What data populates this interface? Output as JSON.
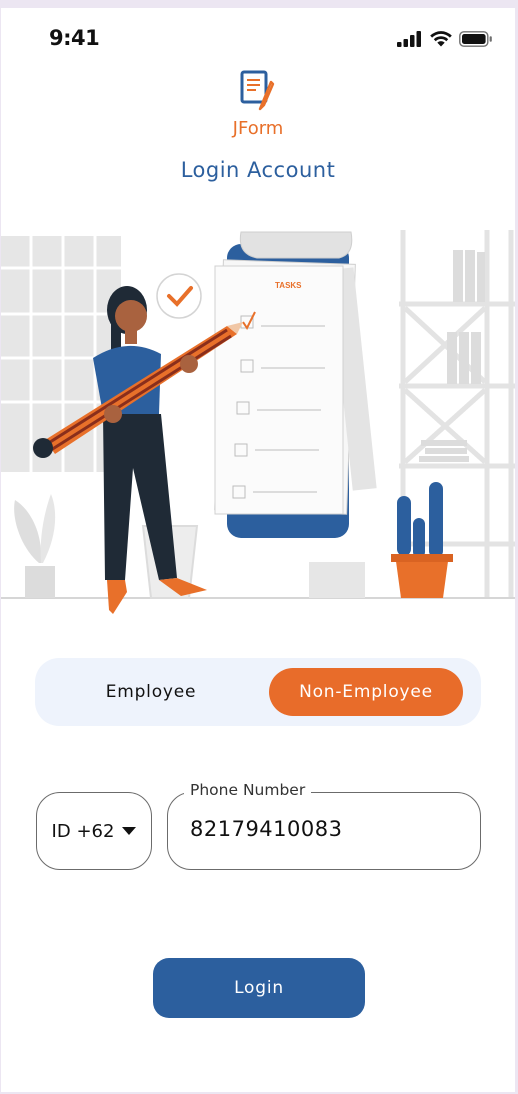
{
  "status": {
    "time": "9:41"
  },
  "brand": {
    "name": "JForm",
    "logo_icon": "document-pencil-icon",
    "accent": "#e8702a",
    "primary": "#2c5f9e"
  },
  "page": {
    "title": "Login Account"
  },
  "illustration": {
    "checklist_header": "TASKS"
  },
  "user_type": {
    "options": [
      "Employee",
      "Non-Employee"
    ],
    "selected": "Non-Employee"
  },
  "phone": {
    "country_code": "ID +62",
    "label": "Phone Number",
    "value": "82179410083"
  },
  "actions": {
    "login_label": "Login"
  }
}
